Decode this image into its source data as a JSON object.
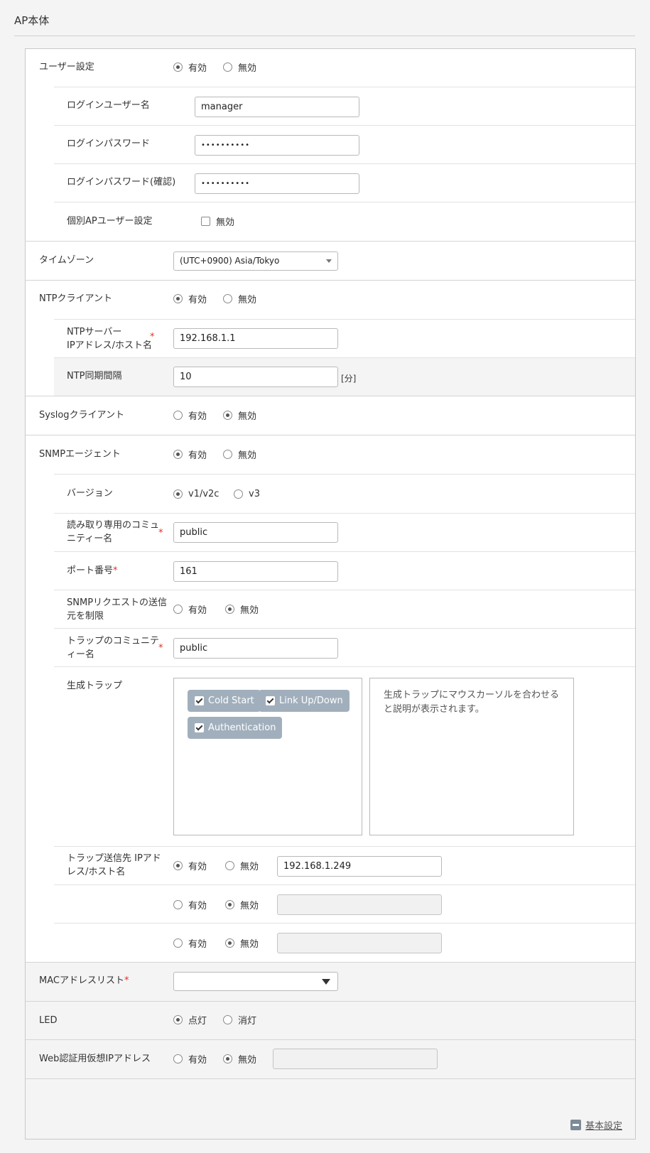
{
  "header": {
    "title": "AP本体"
  },
  "opt": {
    "enabled": "有効",
    "disabled": "無効",
    "on": "点灯",
    "off": "消灯",
    "v1v2c": "v1/v2c",
    "v3": "v3"
  },
  "user": {
    "label": "ユーザー設定",
    "login_name_label": "ログインユーザー名",
    "login_name_value": "manager",
    "password_label": "ログインパスワード",
    "password_value": "••••••••••",
    "password_confirm_label": "ログインパスワード(確認)",
    "password_confirm_value": "••••••••••",
    "individual_label": "個別APユーザー設定"
  },
  "timezone": {
    "label": "タイムゾーン",
    "value": "(UTC+0900) Asia/Tokyo"
  },
  "ntp": {
    "label": "NTPクライアント",
    "server_label_1": "NTPサーバー",
    "server_label_2": "IPアドレス/ホスト名",
    "server_value": "192.168.1.1",
    "interval_label": "NTP同期間隔",
    "interval_value": "10",
    "interval_unit": "[分]"
  },
  "syslog": {
    "label": "Syslogクライアント"
  },
  "snmp": {
    "label": "SNMPエージェント",
    "version_label": "バージョン",
    "ro_label_1": "読み取り専用のコミュ",
    "ro_label_2": "ニティー名",
    "ro_value": "public",
    "port_label": "ポート番号",
    "port_value": "161",
    "restrict_label_1": "SNMPリクエストの送信",
    "restrict_label_2": "元を制限",
    "trap_comm_label_1": "トラップのコミュニテ",
    "trap_comm_label_2": "ィー名",
    "trap_comm_value": "public",
    "gen_trap_label": "生成トラップ",
    "traps": [
      "Cold Start",
      "Link Up/Down",
      "Authentication"
    ],
    "trap_desc_1": "生成トラップにマウスカーソルを合わせる",
    "trap_desc_2": "と説明が表示されます。",
    "dest_label_1": "トラップ送信先 IPアド",
    "dest_label_2": "レス/ホスト名",
    "dest_values": [
      "192.168.1.249",
      "",
      ""
    ]
  },
  "mac": {
    "label": "MACアドレスリスト",
    "value": ""
  },
  "led": {
    "label": "LED"
  },
  "webauth": {
    "label": "Web認証用仮想IPアドレス",
    "value": ""
  },
  "required_mark": "*",
  "footer": {
    "link": "基本設定"
  }
}
